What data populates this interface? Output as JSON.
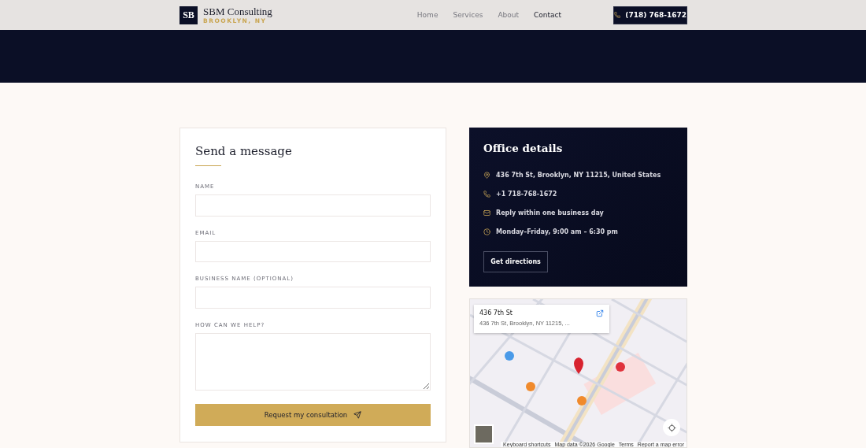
{
  "header": {
    "logo_mark": "SB",
    "brand": "SBM Consulting",
    "location": "BROOKLYN, NY",
    "nav": [
      {
        "label": "Home",
        "selected": false
      },
      {
        "label": "Services",
        "selected": false
      },
      {
        "label": "About",
        "selected": false
      },
      {
        "label": "Contact",
        "selected": true
      }
    ],
    "phone_button": "(718) 768-1672"
  },
  "form": {
    "title": "Send a message",
    "fields": [
      {
        "label": "NAME",
        "kind": "input"
      },
      {
        "label": "EMAIL",
        "kind": "input"
      },
      {
        "label": "BUSINESS NAME (OPTIONAL)",
        "kind": "input"
      },
      {
        "label": "HOW CAN WE HELP?",
        "kind": "textarea"
      }
    ],
    "submit": "Request my consultation"
  },
  "office": {
    "title": "Office details",
    "items": [
      {
        "kind": "location",
        "text": "436 7th St, Brooklyn, NY 11215, United States"
      },
      {
        "kind": "phone",
        "text": "+1 718-768-1672"
      },
      {
        "kind": "mail",
        "text": "Reply within one business day"
      },
      {
        "kind": "clock",
        "text": "Monday–Friday, 9:00 am – 6:30 pm"
      }
    ],
    "button": "Get directions"
  },
  "map": {
    "kind": "picture",
    "place_title": "436 7th St",
    "place_address": "436 7th St, Brooklyn, NY 11215, ...",
    "footer": [
      "Keyboard shortcuts",
      "Map data ©2026 Google",
      "Terms",
      "Report a map error"
    ]
  }
}
